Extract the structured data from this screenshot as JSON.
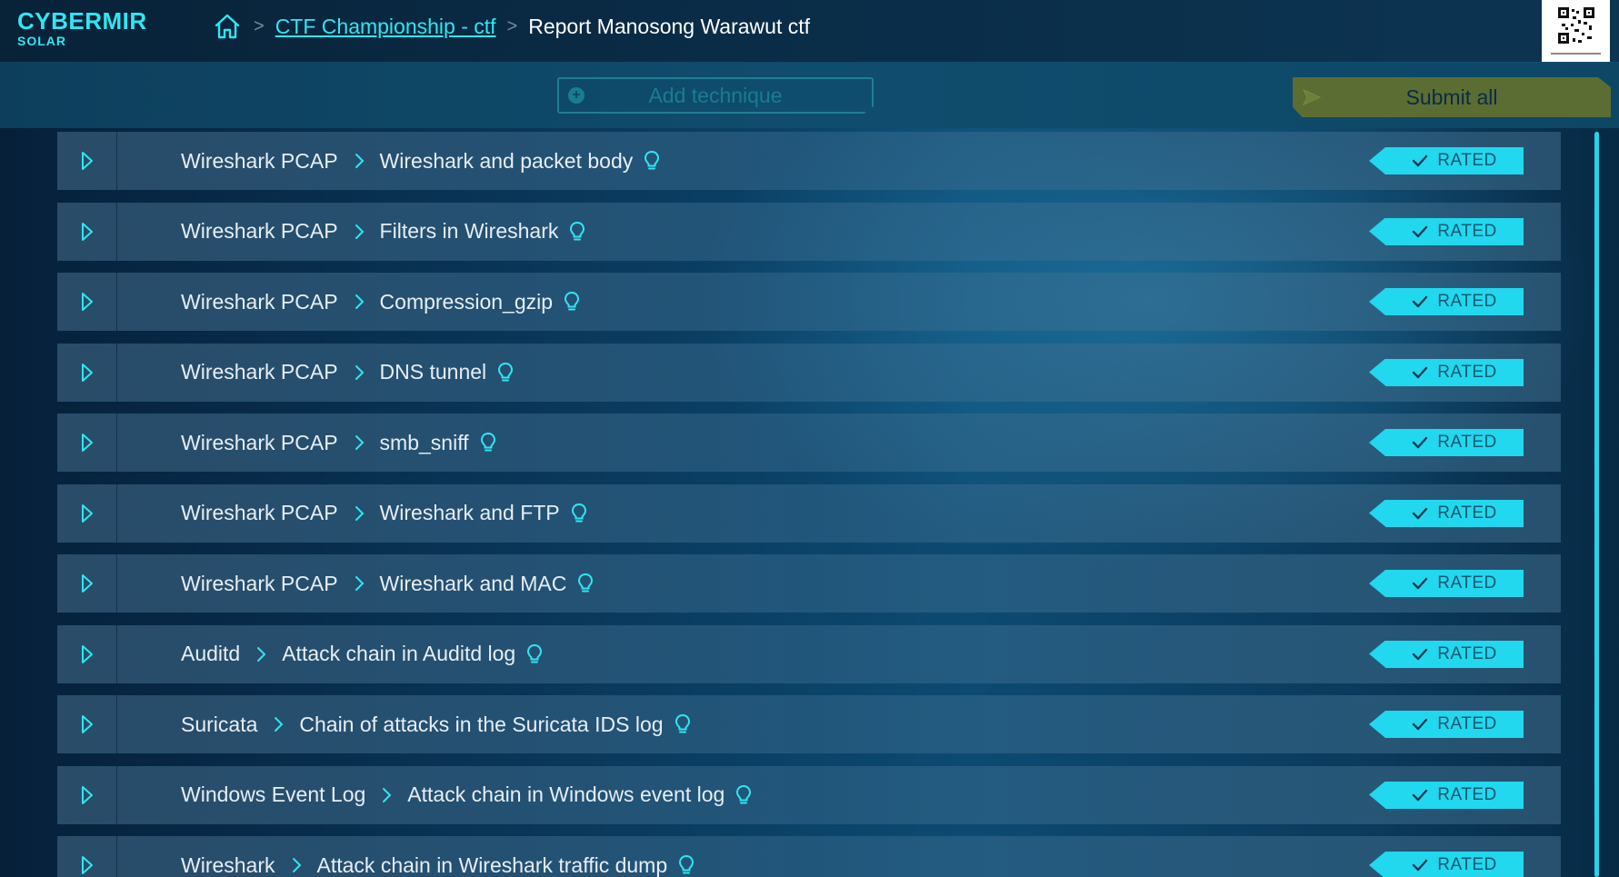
{
  "logo": {
    "main": "CYBERMIR",
    "sub": "SOLAR"
  },
  "breadcrumb": {
    "home_icon": "home-icon",
    "separator": ">",
    "link": "CTF Championship - ctf",
    "current": "Report Manosong Warawut ctf"
  },
  "toolbar": {
    "add_label": "Add technique",
    "submit_label": "Submit all"
  },
  "colors": {
    "accent": "#2ee7f3",
    "badge": "#21d8ee",
    "submit": "#5c6d33"
  },
  "status_label": "RATED",
  "rows": [
    {
      "category": "Wireshark PCAP",
      "technique": "Wireshark and packet body",
      "status": "RATED"
    },
    {
      "category": "Wireshark PCAP",
      "technique": "Filters in Wireshark",
      "status": "RATED"
    },
    {
      "category": "Wireshark PCAP",
      "technique": "Compression_gzip",
      "status": "RATED"
    },
    {
      "category": "Wireshark PCAP",
      "technique": "DNS tunnel",
      "status": "RATED"
    },
    {
      "category": "Wireshark PCAP",
      "technique": "smb_sniff",
      "status": "RATED"
    },
    {
      "category": "Wireshark PCAP",
      "technique": "Wireshark and FTP",
      "status": "RATED"
    },
    {
      "category": "Wireshark PCAP",
      "technique": "Wireshark and MAC",
      "status": "RATED"
    },
    {
      "category": "Auditd",
      "technique": "Attack chain in Auditd log",
      "status": "RATED"
    },
    {
      "category": "Suricata",
      "technique": "Chain of attacks in the Suricata IDS log",
      "status": "RATED"
    },
    {
      "category": "Windows Event Log",
      "technique": "Attack chain in Windows event log",
      "status": "RATED"
    },
    {
      "category": "Wireshark",
      "technique": "Attack chain in Wireshark traffic dump",
      "status": "RATED"
    }
  ]
}
